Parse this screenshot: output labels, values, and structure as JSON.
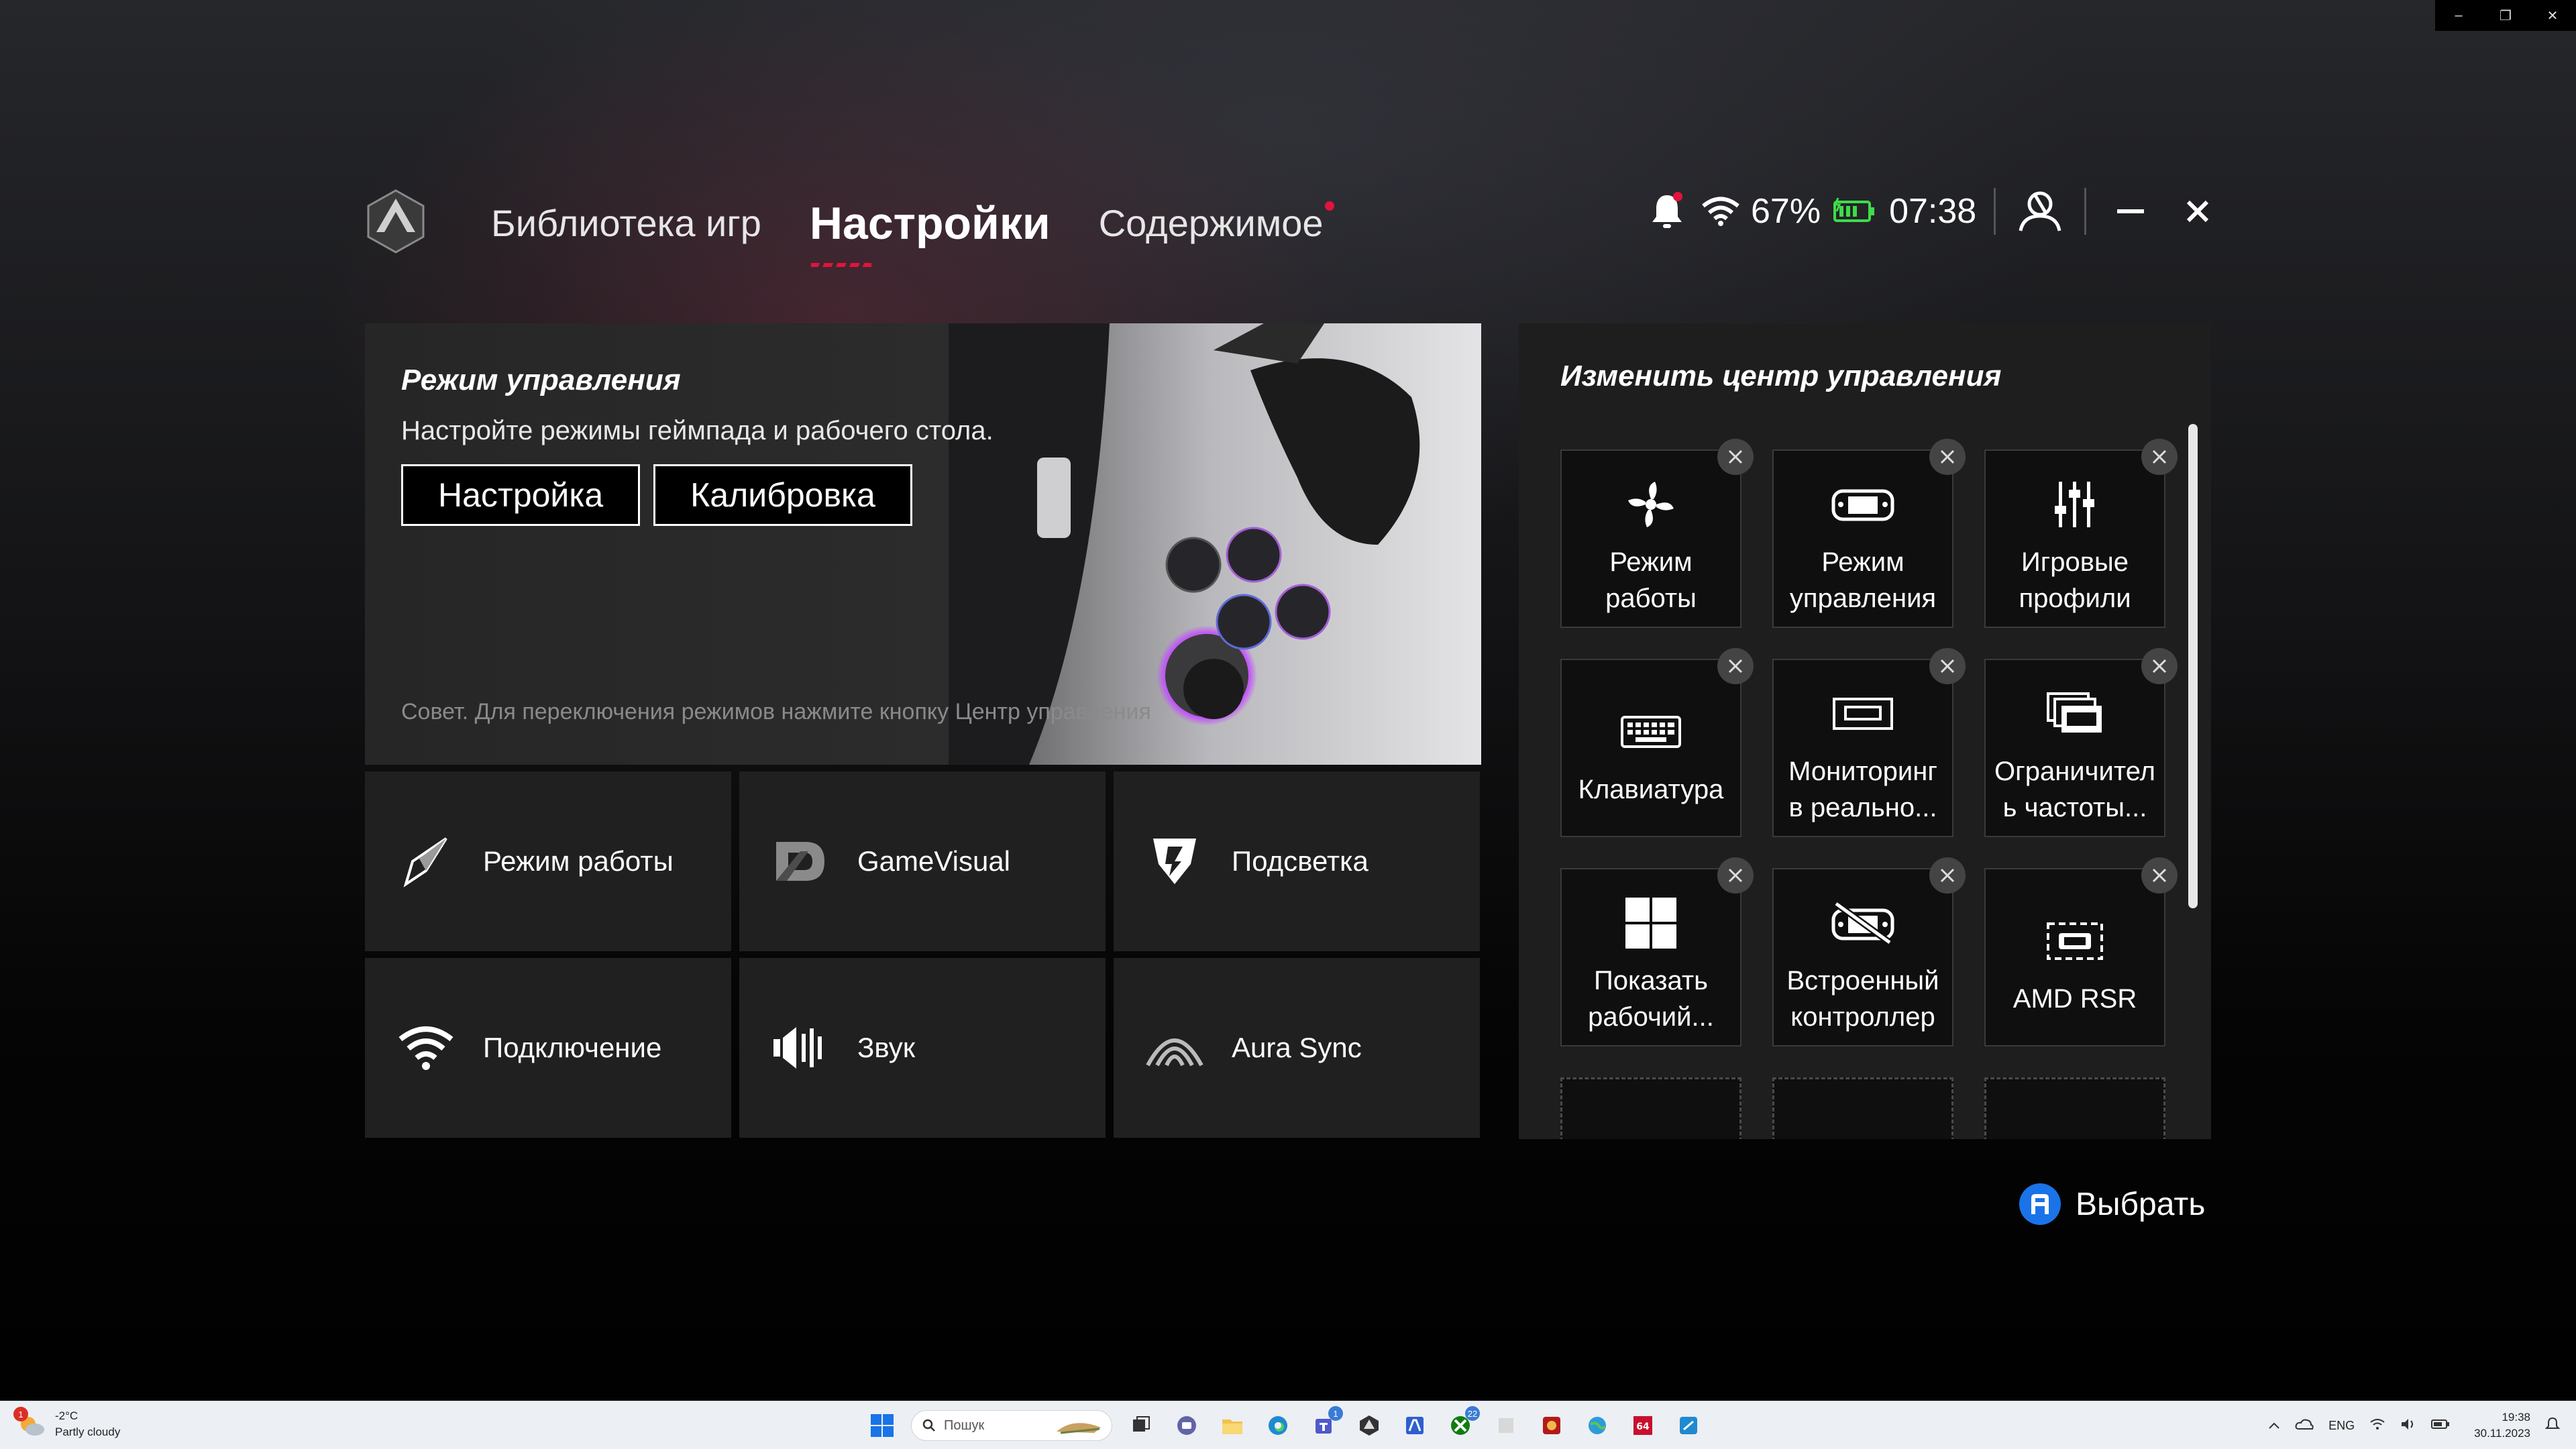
{
  "window_controls": {
    "minimize": "–",
    "restore": "❐",
    "close": "✕"
  },
  "nav": {
    "tabs": [
      {
        "label": "Библиотека игр",
        "active": false
      },
      {
        "label": "Настройки",
        "active": true
      },
      {
        "label": "Содержимое",
        "active": false,
        "notification": true
      }
    ]
  },
  "status": {
    "battery_pct": "67%",
    "time": "07:38",
    "accent": "#e0143c",
    "battery_color": "#3ddc4a"
  },
  "hero": {
    "title": "Режим управления",
    "description": "Настройте режимы геймпада и рабочего стола.",
    "buttons": [
      "Настройка",
      "Калибровка"
    ],
    "tip": "Совет. Для переключения режимов нажмите кнопку Центр управления"
  },
  "tiles": [
    {
      "label": "Режим работы",
      "icon": "operating-mode-icon"
    },
    {
      "label": "GameVisual",
      "icon": "gamevisual-icon"
    },
    {
      "label": "Подсветка",
      "icon": "lighting-icon"
    },
    {
      "label": "Подключение",
      "icon": "wifi-icon"
    },
    {
      "label": "Звук",
      "icon": "sound-icon"
    },
    {
      "label": "Aura Sync",
      "icon": "aura-sync-icon"
    }
  ],
  "control_center": {
    "title": "Изменить центр управления",
    "items": [
      {
        "label": "Режим работы",
        "icon": "fan-icon"
      },
      {
        "label": "Режим управления",
        "icon": "gamepad-icon"
      },
      {
        "label": "Игровые профили",
        "icon": "sliders-icon"
      },
      {
        "label": "Клавиатура",
        "icon": "keyboard-icon"
      },
      {
        "label": "Мониторинг в реально...",
        "icon": "info-monitor-icon"
      },
      {
        "label": "Ограничител ь частоты...",
        "icon": "fps-limiter-icon"
      },
      {
        "label": "Показать рабочий...",
        "icon": "windows-desktop-icon"
      },
      {
        "label": "Встроенный контроллер",
        "icon": "controller-disabled-icon"
      },
      {
        "label": "AMD RSR",
        "icon": "hd-icon"
      }
    ],
    "empty_slots": 3
  },
  "select_hint": {
    "key": "A",
    "label": "Выбрать",
    "key_color": "#1a73e8"
  },
  "taskbar": {
    "weather": {
      "temp": "-2°C",
      "condition": "Partly cloudy",
      "alert_count": "1"
    },
    "search_placeholder": "Пошук",
    "badges": {
      "teams": "1",
      "xbox": "22"
    },
    "tray": {
      "lang": "ENG",
      "time": "19:38",
      "date": "30.11.2023"
    }
  }
}
